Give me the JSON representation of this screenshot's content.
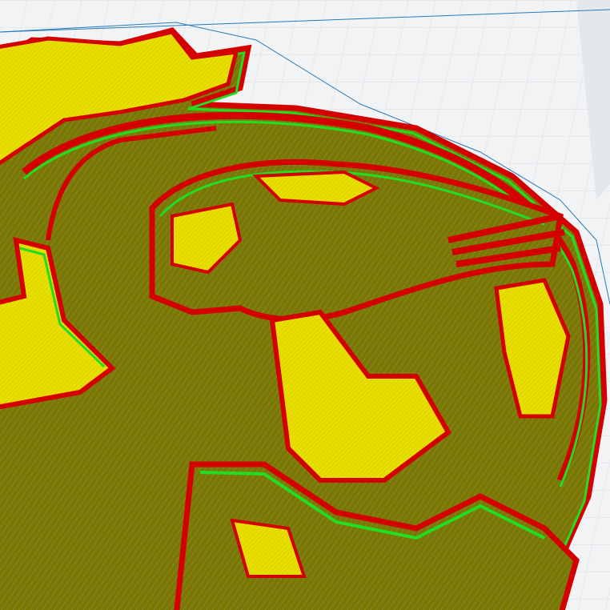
{
  "viewport": {
    "view": "layer-preview",
    "colors": {
      "background": "#f2f3f5",
      "grid": "#d9dde3",
      "build_volume_edge": "#2a7ab8",
      "infill": "#7a7a00",
      "skin": "#e6dc00",
      "outer_wall": "#d40000",
      "inner_wall": "#22dd22",
      "travel": "#8a8aa0"
    }
  }
}
